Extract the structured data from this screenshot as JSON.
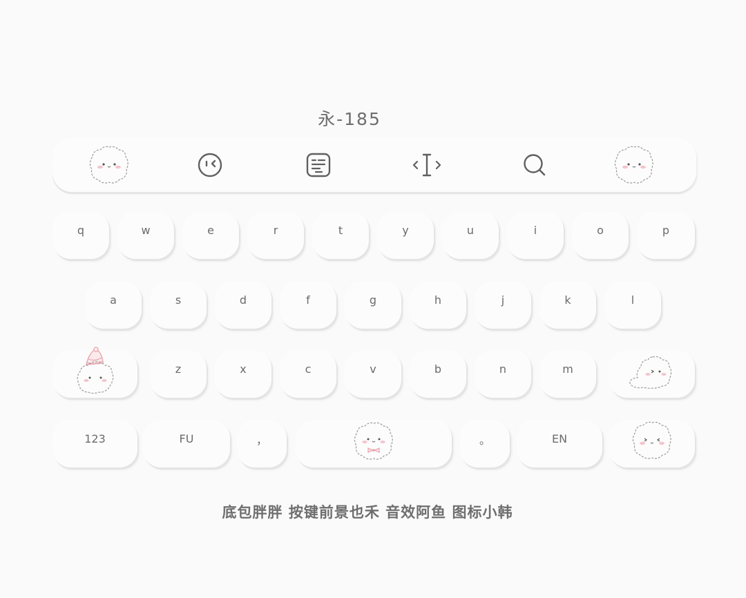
{
  "title": "永-185",
  "toolbar": {
    "left_mascot": "fluffy-mascot-icon",
    "emoji": "emoji-face-icon",
    "keyboard": "keyboard-icon",
    "cursor": "text-cursor-icon",
    "search": "search-icon",
    "right_mascot": "fluffy-mascot-icon"
  },
  "rows": {
    "row1": [
      "q",
      "w",
      "e",
      "r",
      "t",
      "y",
      "u",
      "i",
      "o",
      "p"
    ],
    "row2": [
      "a",
      "s",
      "d",
      "f",
      "g",
      "h",
      "j",
      "k",
      "l"
    ],
    "row3": [
      "z",
      "x",
      "c",
      "v",
      "b",
      "n",
      "m"
    ]
  },
  "bottom": {
    "numbers": "123",
    "fu": "FU",
    "comma": "，",
    "period": "。",
    "en": "EN"
  },
  "footer": "底包胖胖  按键前景也禾  音效阿鱼  图标小韩",
  "colors": {
    "background": "#fafafa",
    "key": "#fcfcfc",
    "key_shadow": "#e5e3e5",
    "text": "#6b6b6b",
    "accent_pink": "#e7a3ad"
  }
}
